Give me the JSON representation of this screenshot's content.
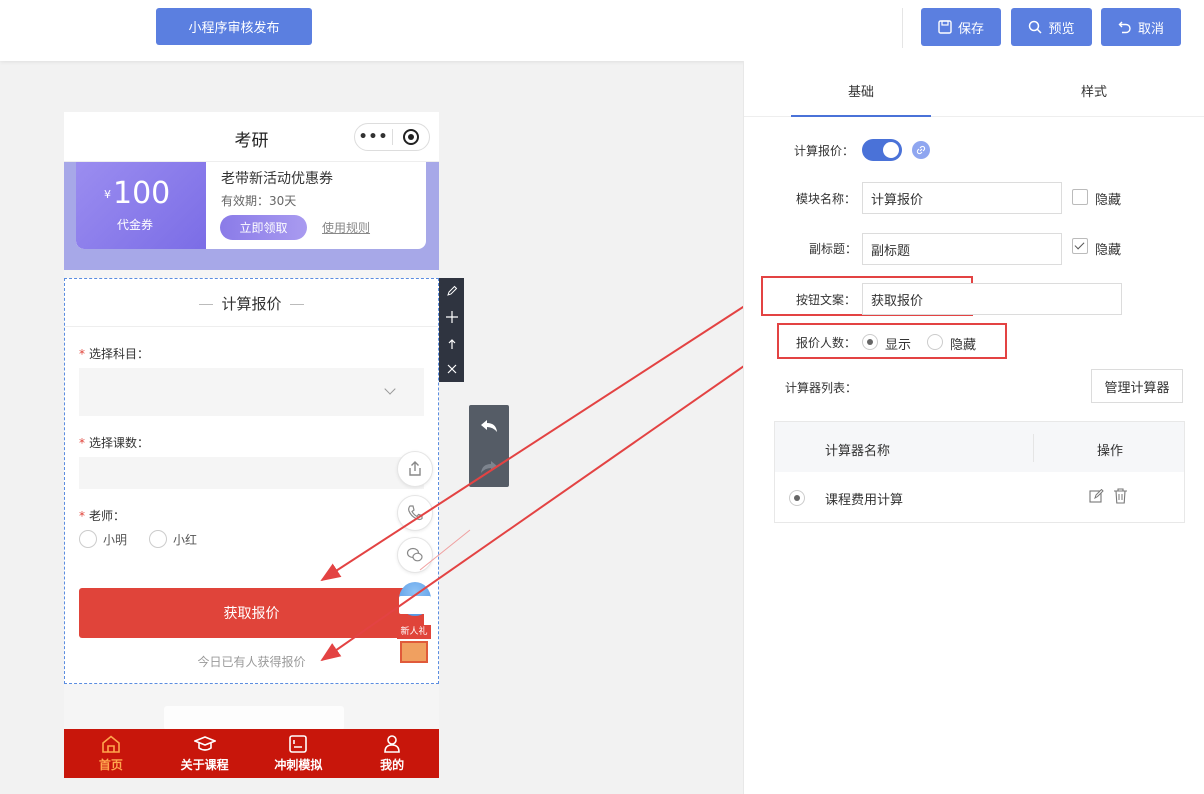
{
  "topbar": {
    "publish_label": "小程序审核发布",
    "save_label": "保存",
    "preview_label": "预览",
    "cancel_label": "取消"
  },
  "phone": {
    "title": "考研",
    "capsule_more": "•••",
    "coupon": {
      "currency": "¥",
      "amount": "100",
      "type": "代金券",
      "title": "老带新活动优惠券",
      "validity": "有效期：30天",
      "claim_label": "立即领取",
      "rules_label": "使用规则"
    },
    "calc": {
      "title": "计算报价",
      "fields": [
        {
          "label": "选择科目："
        },
        {
          "label": "选择课数："
        },
        {
          "label": "老师："
        }
      ],
      "teachers": [
        "小明",
        "小红"
      ],
      "submit_label": "获取报价",
      "today_text": "今日已有人获得报价"
    },
    "gift_label": "新人礼",
    "tabs": [
      {
        "label": "首页",
        "icon": "home-icon",
        "active": true
      },
      {
        "label": "关于课程",
        "icon": "graduation-cap-icon",
        "active": false
      },
      {
        "label": "冲刺模拟",
        "icon": "exam-icon",
        "active": false
      },
      {
        "label": "我的",
        "icon": "user-icon",
        "active": false
      }
    ]
  },
  "panel": {
    "tabs": [
      "基础",
      "样式"
    ],
    "calc_price_label": "计算报价：",
    "module_name_label": "模块名称：",
    "module_name_value": "计算报价",
    "subtitle_label": "副标题：",
    "subtitle_value": "副标题",
    "hide_label": "隐藏",
    "button_text_label": "按钮文案：",
    "button_text_value": "获取报价",
    "quote_count_label": "报价人数：",
    "show_label": "显示",
    "hide_radio_label": "隐藏",
    "calc_list_label": "计算器列表：",
    "manage_btn_label": "管理计算器",
    "table": {
      "headers": [
        "计算器名称",
        "操作"
      ],
      "rows": [
        {
          "name": "课程费用计算"
        }
      ]
    }
  },
  "colors": {
    "primary": "#5b7fe0",
    "submit": "#e0443a",
    "tabbar": "#c8160b",
    "highlight_box": "#e34343"
  }
}
